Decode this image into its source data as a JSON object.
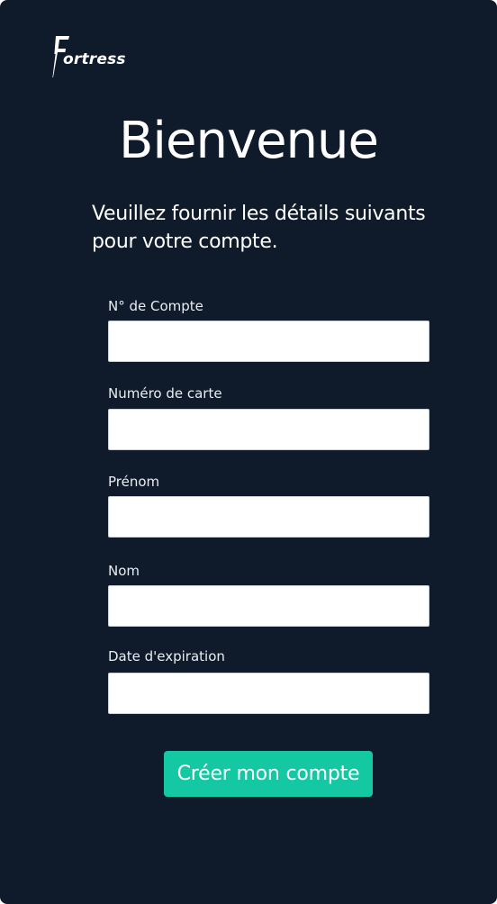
{
  "brand": {
    "logo_text": "ortress",
    "logo_letter": "F"
  },
  "header": {
    "title": "Bienvenue",
    "subtitle": "Veuillez fournir les détails suivants pour votre compte."
  },
  "form": {
    "fields": [
      {
        "label": "N° de Compte",
        "value": "",
        "placeholder": ""
      },
      {
        "label": "Numéro de carte",
        "value": "",
        "placeholder": ""
      },
      {
        "label": "Prénom",
        "value": "",
        "placeholder": ""
      },
      {
        "label": "Nom",
        "value": "",
        "placeholder": ""
      },
      {
        "label": "Date d'expiration",
        "value": "",
        "placeholder": ""
      }
    ],
    "submit_label": "Créer mon compte"
  },
  "colors": {
    "background": "#0f1b2a",
    "accent": "#14c8a4",
    "text": "#ffffff",
    "input_background": "#ffffff"
  }
}
